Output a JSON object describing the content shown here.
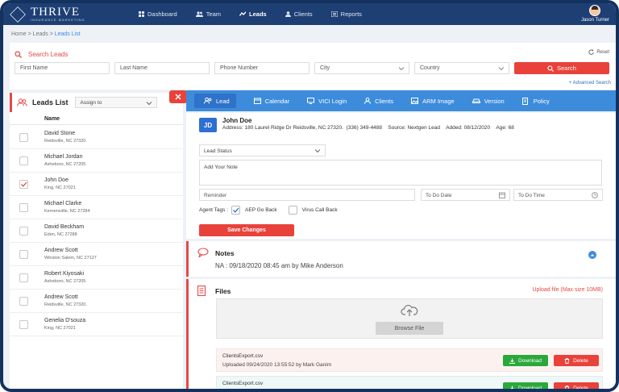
{
  "header": {
    "logo_text": "THRIVE",
    "logo_sub": "INSURANCE MARKETING",
    "nav": [
      {
        "label": "Dashboard",
        "icon": "grid-icon",
        "active": false
      },
      {
        "label": "Team",
        "icon": "team-icon",
        "active": false
      },
      {
        "label": "Leads",
        "icon": "leads-icon",
        "active": true
      },
      {
        "label": "Clients",
        "icon": "clients-icon",
        "active": false
      },
      {
        "label": "Reports",
        "icon": "reports-icon",
        "active": false
      }
    ],
    "user_name": "Jason Turner"
  },
  "breadcrumb": {
    "home": "Home",
    "sep1": " > ",
    "leads": "Leads",
    "sep2": " > ",
    "current": "Leads List"
  },
  "search": {
    "title": "Search Leads",
    "reset": "Reset",
    "first_name": "First Name",
    "last_name": "Last Name",
    "phone": "Phone Number",
    "city": "City",
    "country": "Country",
    "button": "Search",
    "advanced": "+ Advanced Search"
  },
  "leads": {
    "title": "Leads List",
    "assign": "Assign to",
    "column": "Name",
    "rows": [
      {
        "name": "David Stone",
        "addr": "Reidsville, NC 27320.",
        "checked": false
      },
      {
        "name": "Michael Jordan",
        "addr": "Asheboro, NC 27205",
        "checked": false
      },
      {
        "name": "John Doe",
        "addr": "King, NC 27021",
        "checked": true
      },
      {
        "name": "Michael Clarke",
        "addr": "Kernersville, NC 27284",
        "checked": false
      },
      {
        "name": "David Beckham",
        "addr": "Eden, NC 27288",
        "checked": false
      },
      {
        "name": "Andrew Scott",
        "addr": "Winston Salem, NC 27127",
        "checked": false
      },
      {
        "name": "Robert Kiyosaki",
        "addr": "Asheboro, NC 27205",
        "checked": false
      },
      {
        "name": "Andrew Scott",
        "addr": "Reidsville, NC 27320.",
        "checked": false
      },
      {
        "name": "Genelia D'souza",
        "addr": "King, NC 27021",
        "checked": false
      }
    ]
  },
  "tabs": [
    {
      "label": "Lead",
      "icon": "lead-icon",
      "active": true
    },
    {
      "label": "Calendar",
      "icon": "calendar-icon",
      "active": false
    },
    {
      "label": "VICI Login",
      "icon": "monitor-icon",
      "active": false
    },
    {
      "label": "Clients",
      "icon": "clients-icon",
      "active": false
    },
    {
      "label": "ARM Image",
      "icon": "image-icon",
      "active": false
    },
    {
      "label": "Version",
      "icon": "car-icon",
      "active": false
    },
    {
      "label": "Policy",
      "icon": "policy-icon",
      "active": false
    }
  ],
  "lead": {
    "initials": "JD",
    "name": "John Doe",
    "address_label": "Address:",
    "address": "180 Laurel Ridge Dr Reidsville, NC 27320.",
    "phone": "(336) 349-4488",
    "source_label": "Source:",
    "source": "Nextgen Lead",
    "added_label": "Added:",
    "added": "08/12/2020",
    "age_label": "Age:",
    "age": "68",
    "status_placeholder": "Lead Status",
    "note_placeholder": "Add Your Note",
    "reminder_placeholder": "Reminder",
    "todo_date": "To Do Date",
    "todo_time": "To Do Time",
    "tags_label": "Agent Tags :",
    "tag1": "AEP Go Back",
    "tag1_checked": true,
    "tag2": "Virus Call Back",
    "tag2_checked": false,
    "save": "Save Changes"
  },
  "notes": {
    "title": "Notes",
    "text": "NA : 09/18/2020 08:45 am by Mike Anderson"
  },
  "files": {
    "title": "Files",
    "upload": "Upload file (Max size 10MB)",
    "browse": "Browse File",
    "download": "Download",
    "delete": "Delete",
    "items": [
      {
        "name": "ClientsExport.csv",
        "uploaded": "Uploaded 09/24/2020 13:55:52 by Mark Ganim",
        "bg": "#fdf1f0"
      },
      {
        "name": "ClientsExport.csv",
        "uploaded": "Uploaded 09/24/2020 13:55:52 by Mark Ganim",
        "bg": "#eef8f9"
      }
    ]
  },
  "colors": {
    "navy": "#1d3f74",
    "accent_red": "#e8423b",
    "tab_blue": "#3d8cdc",
    "green": "#2aa83a"
  }
}
